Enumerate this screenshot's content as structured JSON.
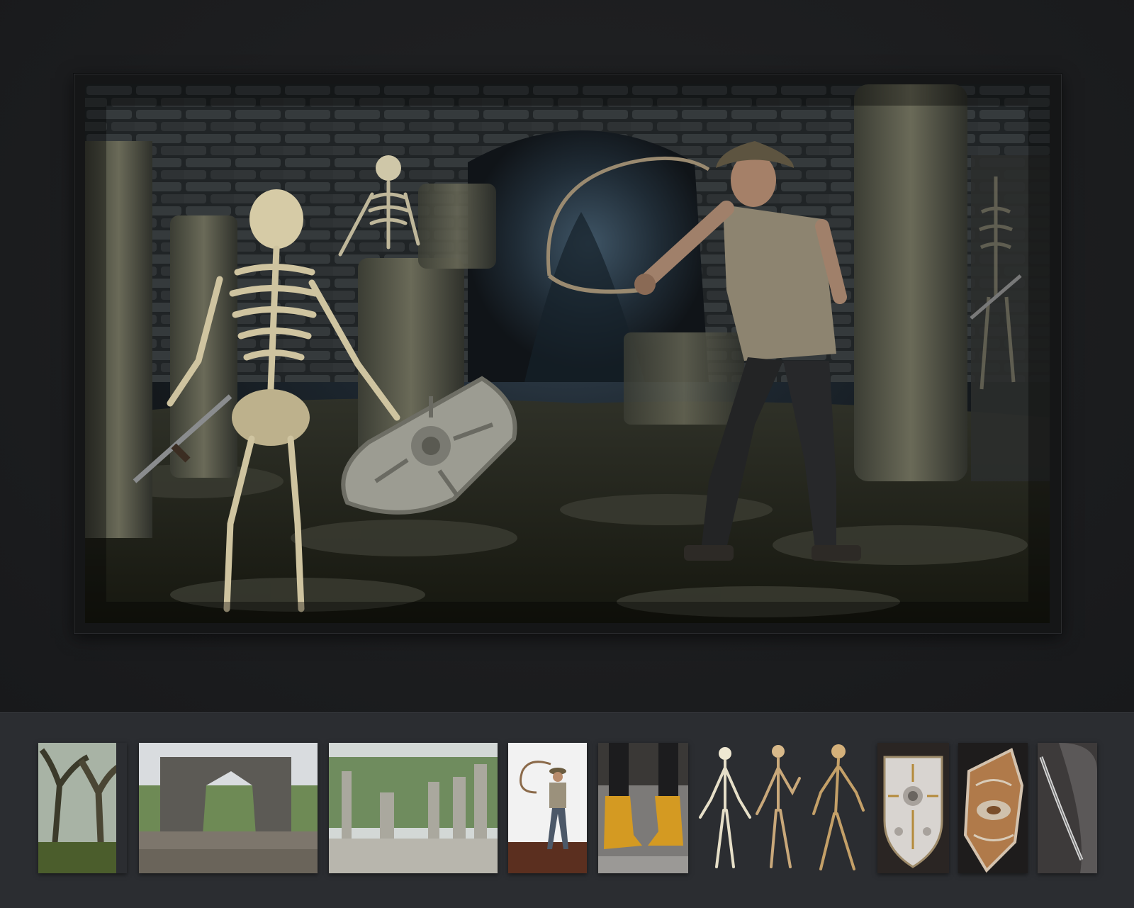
{
  "viewer": {
    "main_image": {
      "icon": "photo-composite-icon",
      "scene": "skeleton-ruins-whip-adventurer"
    },
    "thumbnails": [
      {
        "icon": "forest-thumbnail-icon"
      },
      {
        "icon": "stone-arch-ruins-thumbnail-icon"
      },
      {
        "icon": "stone-columns-ruins-thumbnail-icon"
      },
      {
        "icon": "man-with-whip-thumbnail-icon"
      },
      {
        "icon": "yellow-boots-thumbnail-icon"
      },
      {
        "icon": "skeletons-thumbnail-icon"
      },
      {
        "icon": "skull-shield-thumbnail-icon"
      },
      {
        "icon": "ornate-shield-thumbnail-icon"
      },
      {
        "icon": "sword-blade-thumbnail-icon"
      }
    ],
    "colors": {
      "background": "#1b1c1e",
      "strip": "#2b2d31",
      "frame": "#151617"
    }
  }
}
